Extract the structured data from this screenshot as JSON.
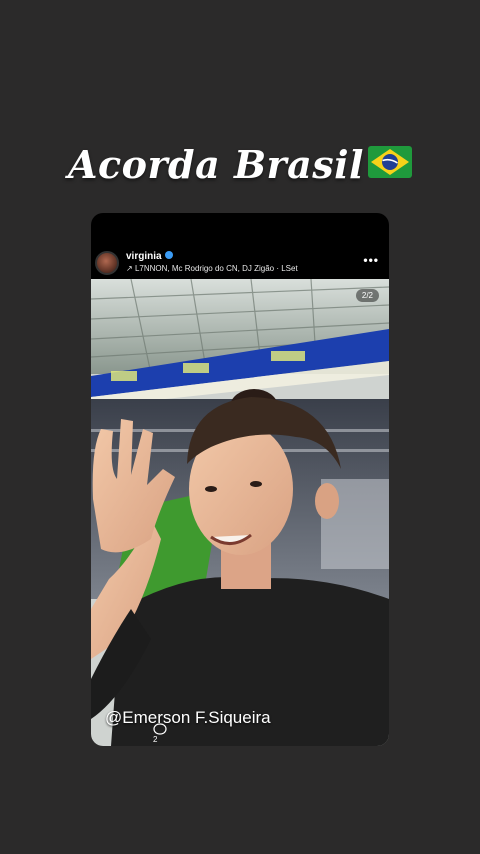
{
  "story": {
    "caption_text": "Acorda Brasil",
    "caption_flag": "brazil-flag"
  },
  "post": {
    "username": "virginia",
    "verified": true,
    "music_arrow": "↗",
    "music_line": "L7NNON, Mc Rodrigo do CN, DJ Zigão · LSet",
    "more_label": "•••",
    "page_counter": "2/2",
    "credit": "@Emerson F.Siqueira",
    "mini_icons_label": "2"
  },
  "colors": {
    "background": "#2b2a2a",
    "card": "#000000",
    "verified_badge": "#3b9cf5",
    "stadium_blue": "#1c3fae",
    "pitch_green": "#3f9a2f"
  }
}
